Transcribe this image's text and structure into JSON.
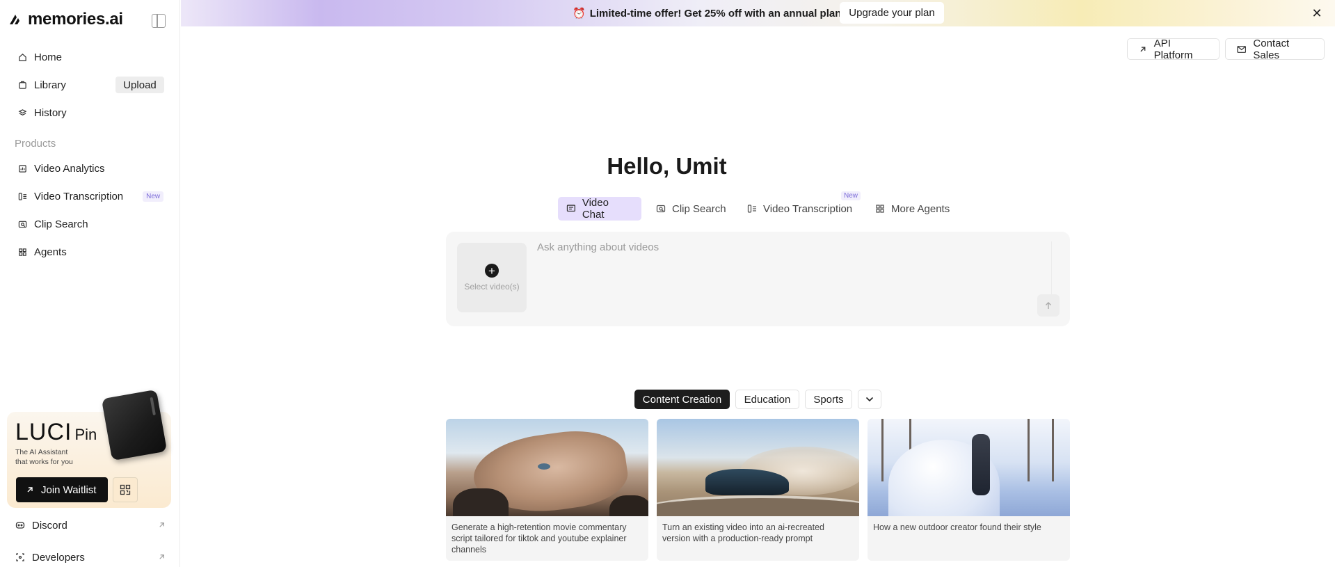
{
  "sidebar": {
    "logo": "memories.ai",
    "nav": [
      {
        "label": "Home",
        "icon": "home-icon"
      },
      {
        "label": "Library",
        "icon": "library-icon"
      },
      {
        "label": "History",
        "icon": "history-icon"
      }
    ],
    "upload_label": "Upload",
    "products_label": "Products",
    "products": [
      {
        "label": "Video Analytics",
        "icon": "analytics-icon"
      },
      {
        "label": "Video Transcription",
        "icon": "transcription-icon",
        "badge": "New"
      },
      {
        "label": "Clip Search",
        "icon": "clip-search-icon"
      },
      {
        "label": "Agents",
        "icon": "agents-icon"
      }
    ],
    "promo": {
      "title": "LUCI",
      "title_suffix": "Pin",
      "subtitle_line1": "The AI Assistant",
      "subtitle_line2": "that works for you",
      "join_label": "Join Waitlist"
    },
    "footer": [
      {
        "label": "Discord",
        "icon": "discord-icon"
      },
      {
        "label": "Developers",
        "icon": "developers-icon"
      }
    ]
  },
  "banner": {
    "message": "Limited-time offer! Get 25% off with an annual plan!",
    "upgrade_label": "Upgrade your plan"
  },
  "top_actions": {
    "api_label": "API Platform",
    "contact_label": "Contact Sales"
  },
  "main": {
    "greeting": "Hello, Umit",
    "modes": [
      {
        "label": "Video Chat",
        "active": true
      },
      {
        "label": "Clip Search",
        "active": false
      },
      {
        "label": "Video Transcription",
        "active": false,
        "badge": "New"
      },
      {
        "label": "More Agents",
        "active": false
      }
    ],
    "chat": {
      "select_label": "Select video(s)",
      "placeholder": "Ask anything about videos"
    },
    "categories": [
      {
        "label": "Content Creation",
        "active": true
      },
      {
        "label": "Education",
        "active": false
      },
      {
        "label": "Sports",
        "active": false
      }
    ],
    "cards": [
      {
        "text": "Generate a high-retention movie commentary script tailored for tiktok and youtube explainer channels"
      },
      {
        "text": "Turn an existing video into an ai-recreated version with a production-ready prompt"
      },
      {
        "text": "How a new outdoor creator found their style"
      }
    ]
  }
}
